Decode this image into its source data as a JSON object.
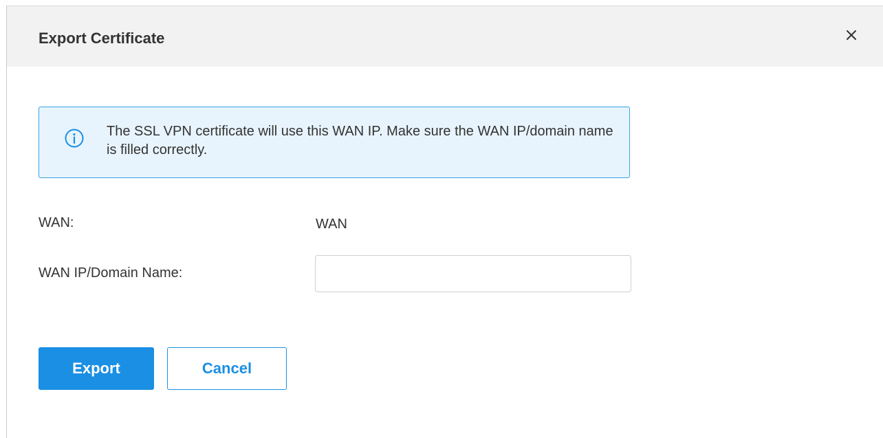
{
  "dialog": {
    "title": "Export Certificate",
    "close_icon": "close-icon"
  },
  "notice": {
    "icon": "info-circle-icon",
    "text": "The SSL VPN certificate will use this WAN IP. Make sure the WAN IP/domain name is filled correctly."
  },
  "form": {
    "wan_label": "WAN:",
    "wan_value": "WAN",
    "wan_ip_label": "WAN IP/Domain Name:",
    "wan_ip_value": "",
    "wan_ip_placeholder": ""
  },
  "actions": {
    "export_label": "Export",
    "cancel_label": "Cancel"
  },
  "colors": {
    "accent": "#1a8fe3",
    "notice_bg": "#e8f4fd",
    "notice_border": "#39a0e6",
    "header_bg": "#f2f2f2"
  }
}
